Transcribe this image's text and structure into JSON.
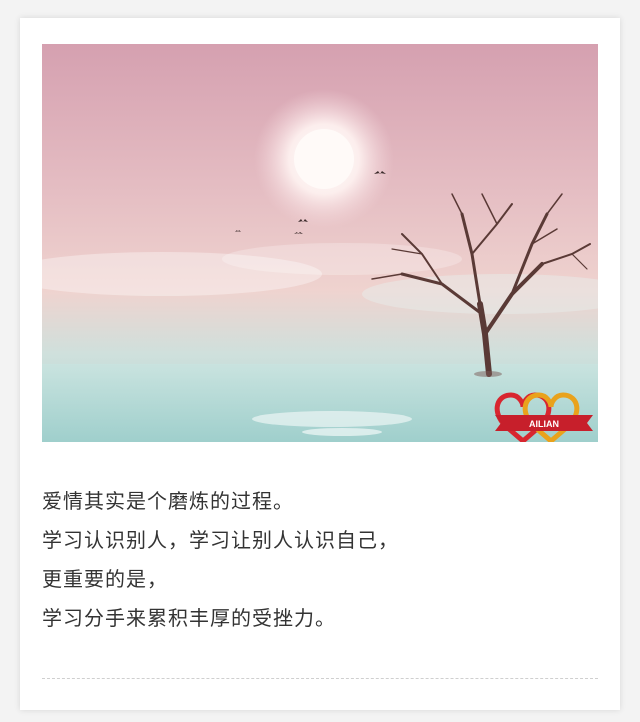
{
  "post": {
    "lines": [
      "爱情其实是个磨炼的过程。",
      "学习认识别人，学习让别人认识自己，",
      "更重要的是，",
      "学习分手来累积丰厚的受挫力。"
    ]
  },
  "watermark": {
    "text": "AILIAN",
    "colors": {
      "heart_left": "#d8262f",
      "heart_right": "#e9a21c",
      "ribbon": "#c71f2b"
    }
  },
  "photo": {
    "sky_top": "#d7a6b4",
    "sky_mid": "#e8c3c6",
    "water": "#a9d6d2",
    "sun": "#fff6f2"
  }
}
